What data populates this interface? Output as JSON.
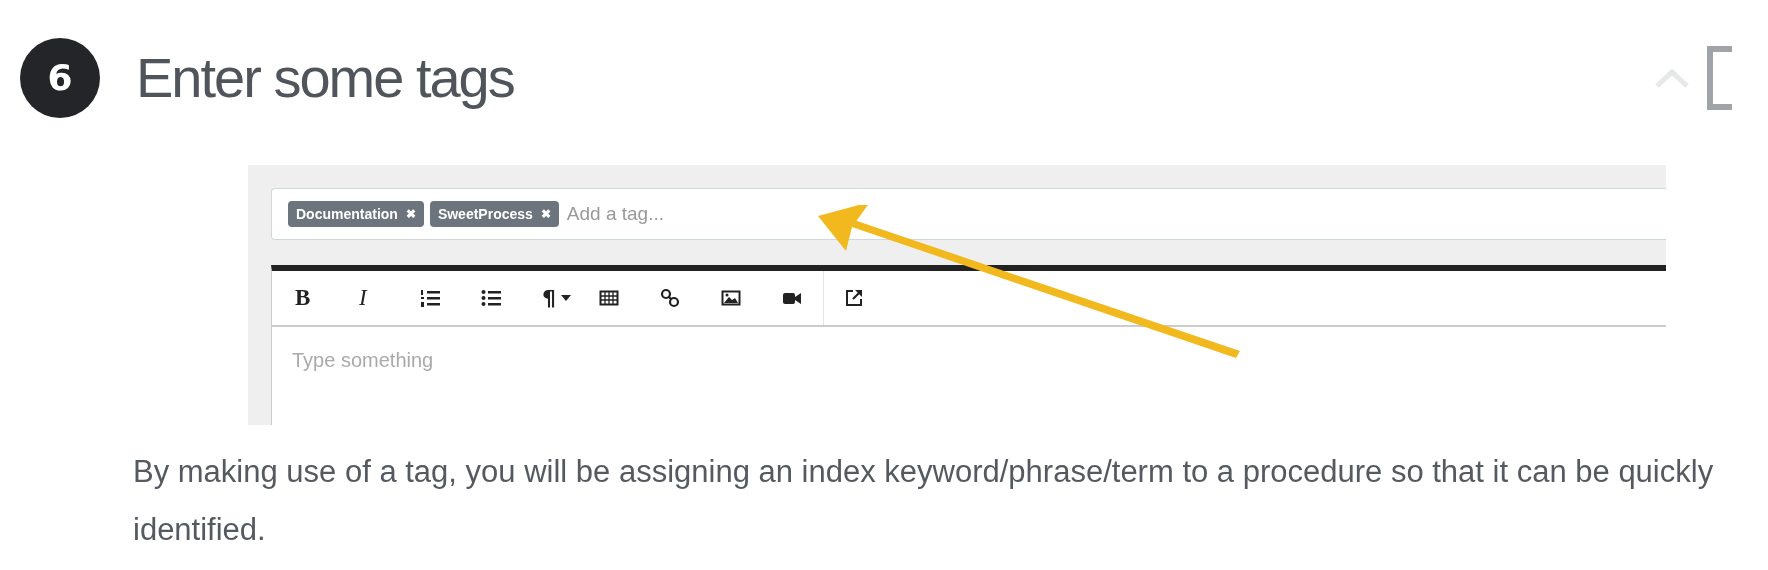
{
  "step": {
    "number": "6",
    "title": "Enter some tags"
  },
  "header_icons": [
    {
      "kind": "chevron-up"
    },
    {
      "kind": "bracket"
    }
  ],
  "screenshot": {
    "tags": [
      {
        "label": "Documentation",
        "remove": "✖"
      },
      {
        "label": "SweetProcess",
        "remove": "✖"
      }
    ],
    "tag_placeholder": "Add a tag...",
    "toolbar": [
      {
        "kind": "bold",
        "label": "B"
      },
      {
        "kind": "italic",
        "label": "I"
      },
      {
        "kind": "ordered-list"
      },
      {
        "kind": "bullet-list"
      },
      {
        "kind": "paragraph",
        "label": "¶"
      },
      {
        "kind": "table"
      },
      {
        "kind": "link"
      },
      {
        "kind": "image"
      },
      {
        "kind": "video"
      },
      {
        "kind": "external",
        "divider_before": true
      }
    ],
    "editor_placeholder": "Type something",
    "arrow": {
      "kind": "arrow"
    }
  },
  "description": "By making use of a tag, you will be assigning an index keyword/phrase/term to a procedure so that it can be quickly identified."
}
